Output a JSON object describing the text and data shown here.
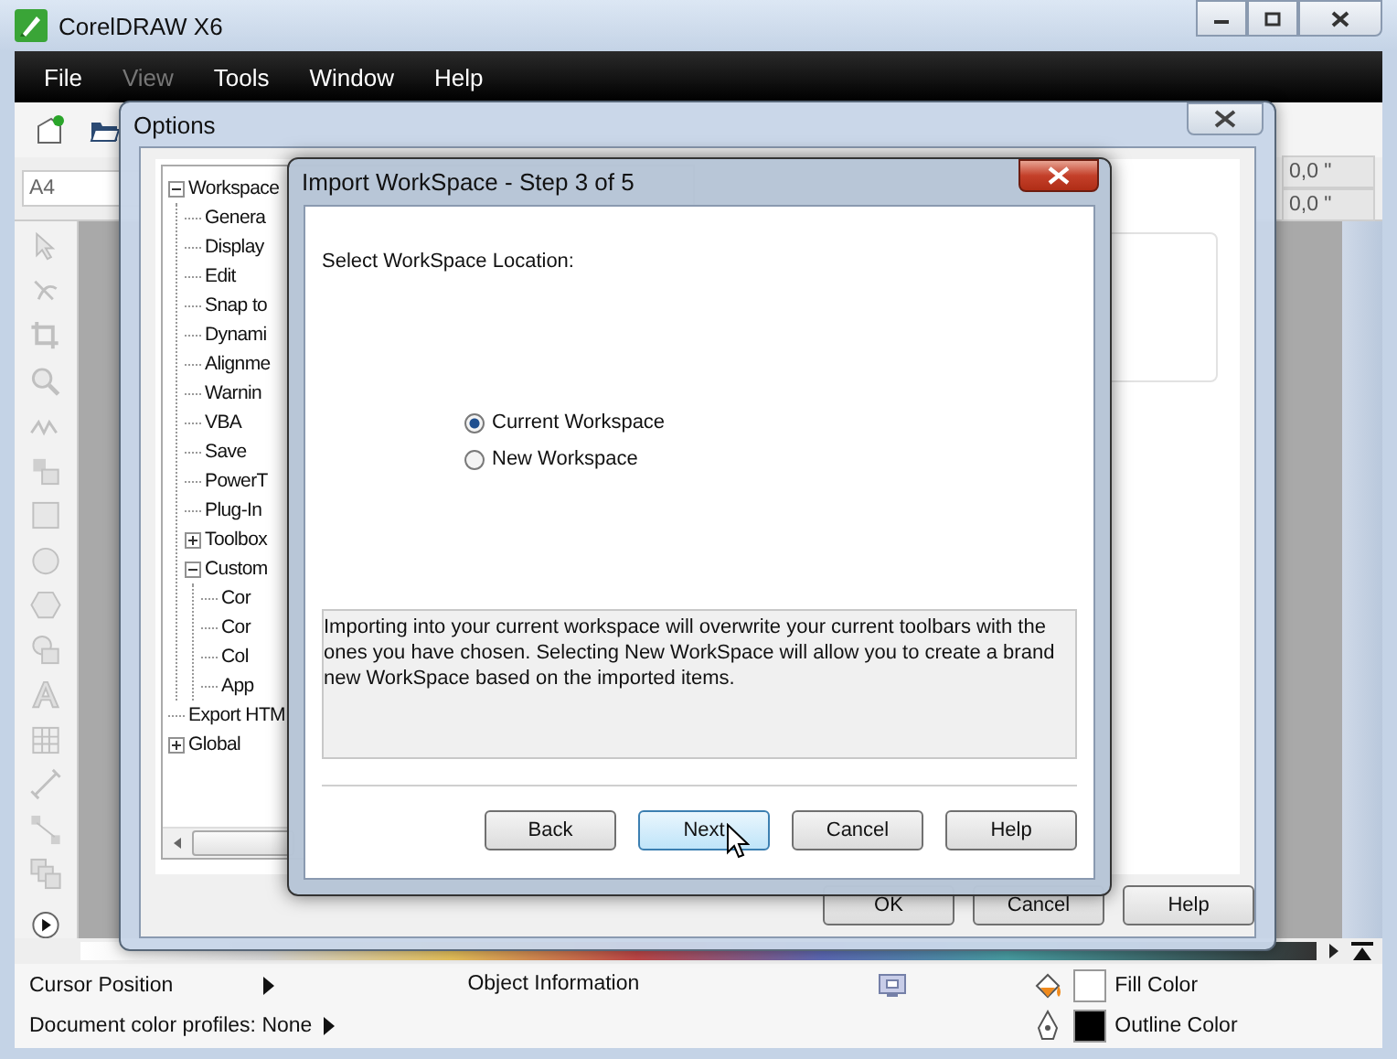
{
  "app": {
    "title": "CorelDRAW X6"
  },
  "menu": [
    {
      "label": "File",
      "disabled": false
    },
    {
      "label": "View",
      "disabled": true
    },
    {
      "label": "Tools",
      "disabled": false
    },
    {
      "label": "Window",
      "disabled": false
    },
    {
      "label": "Help",
      "disabled": false
    }
  ],
  "property_bar": {
    "page_size": "A4",
    "x_value": "0,0 \"",
    "y_value": "0,0 \""
  },
  "options": {
    "title": "Options",
    "tree": [
      {
        "label": "Workspace",
        "expanded": true,
        "children": [
          {
            "label": "Genera"
          },
          {
            "label": "Display"
          },
          {
            "label": "Edit"
          },
          {
            "label": "Snap to"
          },
          {
            "label": "Dynami"
          },
          {
            "label": "Alignme"
          },
          {
            "label": "Warnin"
          },
          {
            "label": "VBA"
          },
          {
            "label": "Save"
          },
          {
            "label": "PowerT"
          },
          {
            "label": "Plug-In"
          },
          {
            "label": "Toolbox",
            "expanded": false
          },
          {
            "label": "Custom",
            "expanded": true,
            "children": [
              {
                "label": "Cor"
              },
              {
                "label": "Cor"
              },
              {
                "label": "Col"
              },
              {
                "label": "App"
              }
            ]
          }
        ]
      },
      {
        "label": "Export HTM"
      },
      {
        "label": "Global",
        "expanded": false
      }
    ],
    "buttons": [
      "OK",
      "Cancel",
      "Help"
    ]
  },
  "import_dialog": {
    "title": "Import WorkSpace - Step 3 of 5",
    "prompt": "Select WorkSpace Location:",
    "choices": [
      {
        "label": "Current Workspace",
        "selected": true
      },
      {
        "label": "New Workspace",
        "selected": false
      }
    ],
    "description": "Importing into your current workspace will overwrite your current toolbars with the ones you have chosen. Selecting New WorkSpace will allow you to create a brand new WorkSpace based on the imported items.",
    "buttons": [
      {
        "label": "Back",
        "hovered": false
      },
      {
        "label": "Next",
        "hovered": true
      },
      {
        "label": "Cancel",
        "hovered": false
      },
      {
        "label": "Help",
        "hovered": false
      }
    ]
  },
  "status_bar": {
    "cursor_position": "Cursor Position",
    "object_information": "Object Information",
    "color_profiles": "Document color profiles: None",
    "swatches": [
      {
        "label": "Fill Color",
        "color": "#ffffff",
        "kind": "fill"
      },
      {
        "label": "Outline Color",
        "color": "#000000",
        "kind": "outline"
      }
    ]
  }
}
